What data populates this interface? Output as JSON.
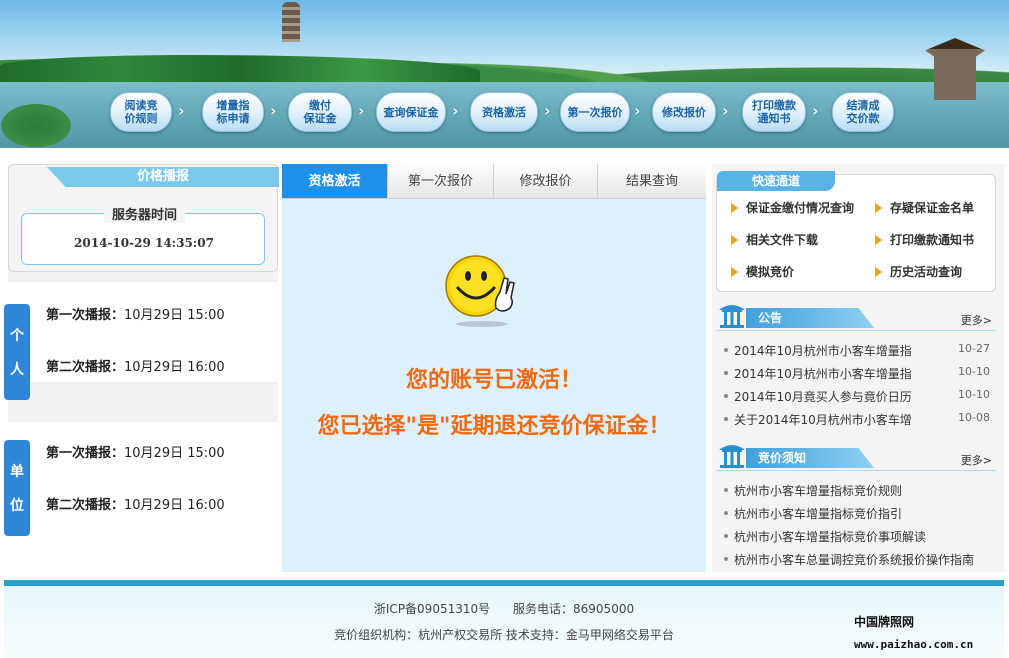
{
  "steps": [
    {
      "line1": "阅读竞",
      "line2": "价规则"
    },
    {
      "line1": "增量指",
      "line2": "标申请"
    },
    {
      "line1": "缴付",
      "line2": "保证金"
    },
    {
      "line1": "查询保证金",
      "line2": ""
    },
    {
      "line1": "资格激活",
      "line2": ""
    },
    {
      "line1": "第一次报价",
      "line2": ""
    },
    {
      "line1": "修改报价",
      "line2": ""
    },
    {
      "line1": "打印缴款",
      "line2": "通知书"
    },
    {
      "line1": "结清成",
      "line2": "交价款"
    }
  ],
  "left": {
    "price_title": "价格播报",
    "server_time_label": "服务器时间",
    "server_time_value": "2014-10-29 14:35:07",
    "groups": [
      {
        "tab_c1": "个",
        "tab_c2": "人",
        "line1_label": "第一次播报：",
        "line1_value": "10月29日 15:00",
        "line2_label": "第二次播报：",
        "line2_value": "10月29日 16:00"
      },
      {
        "tab_c1": "单",
        "tab_c2": "位",
        "line1_label": "第一次播报：",
        "line1_value": "10月29日 15:00",
        "line2_label": "第二次播报：",
        "line2_value": "10月29日 16:00"
      }
    ]
  },
  "center": {
    "tabs": [
      "资格激活",
      "第一次报价",
      "修改报价",
      "结果查询"
    ],
    "message1": "您的账号已激活！",
    "message2": "您已选择\"是\"延期退还竞价保证金！"
  },
  "right": {
    "quick_title": "快速通道",
    "quick_links": [
      "保证金缴付情况查询",
      "存疑保证金名单",
      "相关文件下载",
      "打印缴款通知书",
      "模拟竞价",
      "历史活动查询"
    ],
    "notice_title": "公告",
    "more": "更多>",
    "notices": [
      {
        "text": "2014年10月杭州市小客车增量指",
        "date": "10-27"
      },
      {
        "text": "2014年10月杭州市小客车增量指",
        "date": "10-10"
      },
      {
        "text": "2014年10月竟买人参与竟价日历",
        "date": "10-10"
      },
      {
        "text": "关于2014年10月杭州市小客车增",
        "date": "10-08"
      }
    ],
    "guide_title": "竞价须知",
    "guides": [
      "杭州市小客车增量指标竞价规则",
      "杭州市小客车增量指标竞价指引",
      "杭州市小客车增量指标竞价事项解读",
      "杭州市小客车总量调控竞价系统报价操作指南"
    ]
  },
  "footer": {
    "icp": "浙ICP备09051310号",
    "phone": "服务电话：86905000",
    "org": "竞价组织机构：杭州产权交易所  技术支持：金马甲网络交易平台",
    "watermark1": "中国牌照网",
    "watermark2": "www.paizhao.com.cn"
  },
  "colors": {
    "accent": "#1e90e8",
    "message": "#f06a10",
    "step_text": "#1a63a8"
  },
  "icons": {
    "step_arrow": "chevron-right-icon",
    "quick_bullet": "triangle-right-icon",
    "section": "pavilion-icon",
    "mascot": "smiley-victory-icon"
  }
}
